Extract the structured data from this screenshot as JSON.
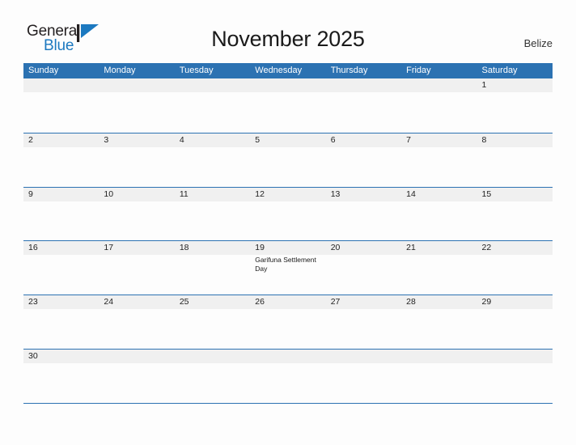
{
  "brand": {
    "name_part1": "General",
    "name_part2": "Blue",
    "flag_icon": "flag-triangle-icon",
    "accent_color": "#1c79c0"
  },
  "header": {
    "title": "November 2025",
    "country": "Belize"
  },
  "theme": {
    "header_blue": "#2c72b2",
    "row_band_gray": "#f0f0f0",
    "page_background": "#fdfdfd"
  },
  "calendar": {
    "day_headers": [
      "Sunday",
      "Monday",
      "Tuesday",
      "Wednesday",
      "Thursday",
      "Friday",
      "Saturday"
    ],
    "weeks": [
      {
        "days": [
          {
            "num": "",
            "events": []
          },
          {
            "num": "",
            "events": []
          },
          {
            "num": "",
            "events": []
          },
          {
            "num": "",
            "events": []
          },
          {
            "num": "",
            "events": []
          },
          {
            "num": "",
            "events": []
          },
          {
            "num": "1",
            "events": []
          }
        ]
      },
      {
        "days": [
          {
            "num": "2",
            "events": []
          },
          {
            "num": "3",
            "events": []
          },
          {
            "num": "4",
            "events": []
          },
          {
            "num": "5",
            "events": []
          },
          {
            "num": "6",
            "events": []
          },
          {
            "num": "7",
            "events": []
          },
          {
            "num": "8",
            "events": []
          }
        ]
      },
      {
        "days": [
          {
            "num": "9",
            "events": []
          },
          {
            "num": "10",
            "events": []
          },
          {
            "num": "11",
            "events": []
          },
          {
            "num": "12",
            "events": []
          },
          {
            "num": "13",
            "events": []
          },
          {
            "num": "14",
            "events": []
          },
          {
            "num": "15",
            "events": []
          }
        ]
      },
      {
        "days": [
          {
            "num": "16",
            "events": []
          },
          {
            "num": "17",
            "events": []
          },
          {
            "num": "18",
            "events": []
          },
          {
            "num": "19",
            "events": [
              "Garifuna Settlement Day"
            ]
          },
          {
            "num": "20",
            "events": []
          },
          {
            "num": "21",
            "events": []
          },
          {
            "num": "22",
            "events": []
          }
        ]
      },
      {
        "days": [
          {
            "num": "23",
            "events": []
          },
          {
            "num": "24",
            "events": []
          },
          {
            "num": "25",
            "events": []
          },
          {
            "num": "26",
            "events": []
          },
          {
            "num": "27",
            "events": []
          },
          {
            "num": "28",
            "events": []
          },
          {
            "num": "29",
            "events": []
          }
        ]
      },
      {
        "days": [
          {
            "num": "30",
            "events": []
          },
          {
            "num": "",
            "events": []
          },
          {
            "num": "",
            "events": []
          },
          {
            "num": "",
            "events": []
          },
          {
            "num": "",
            "events": []
          },
          {
            "num": "",
            "events": []
          },
          {
            "num": "",
            "events": []
          }
        ]
      }
    ]
  }
}
